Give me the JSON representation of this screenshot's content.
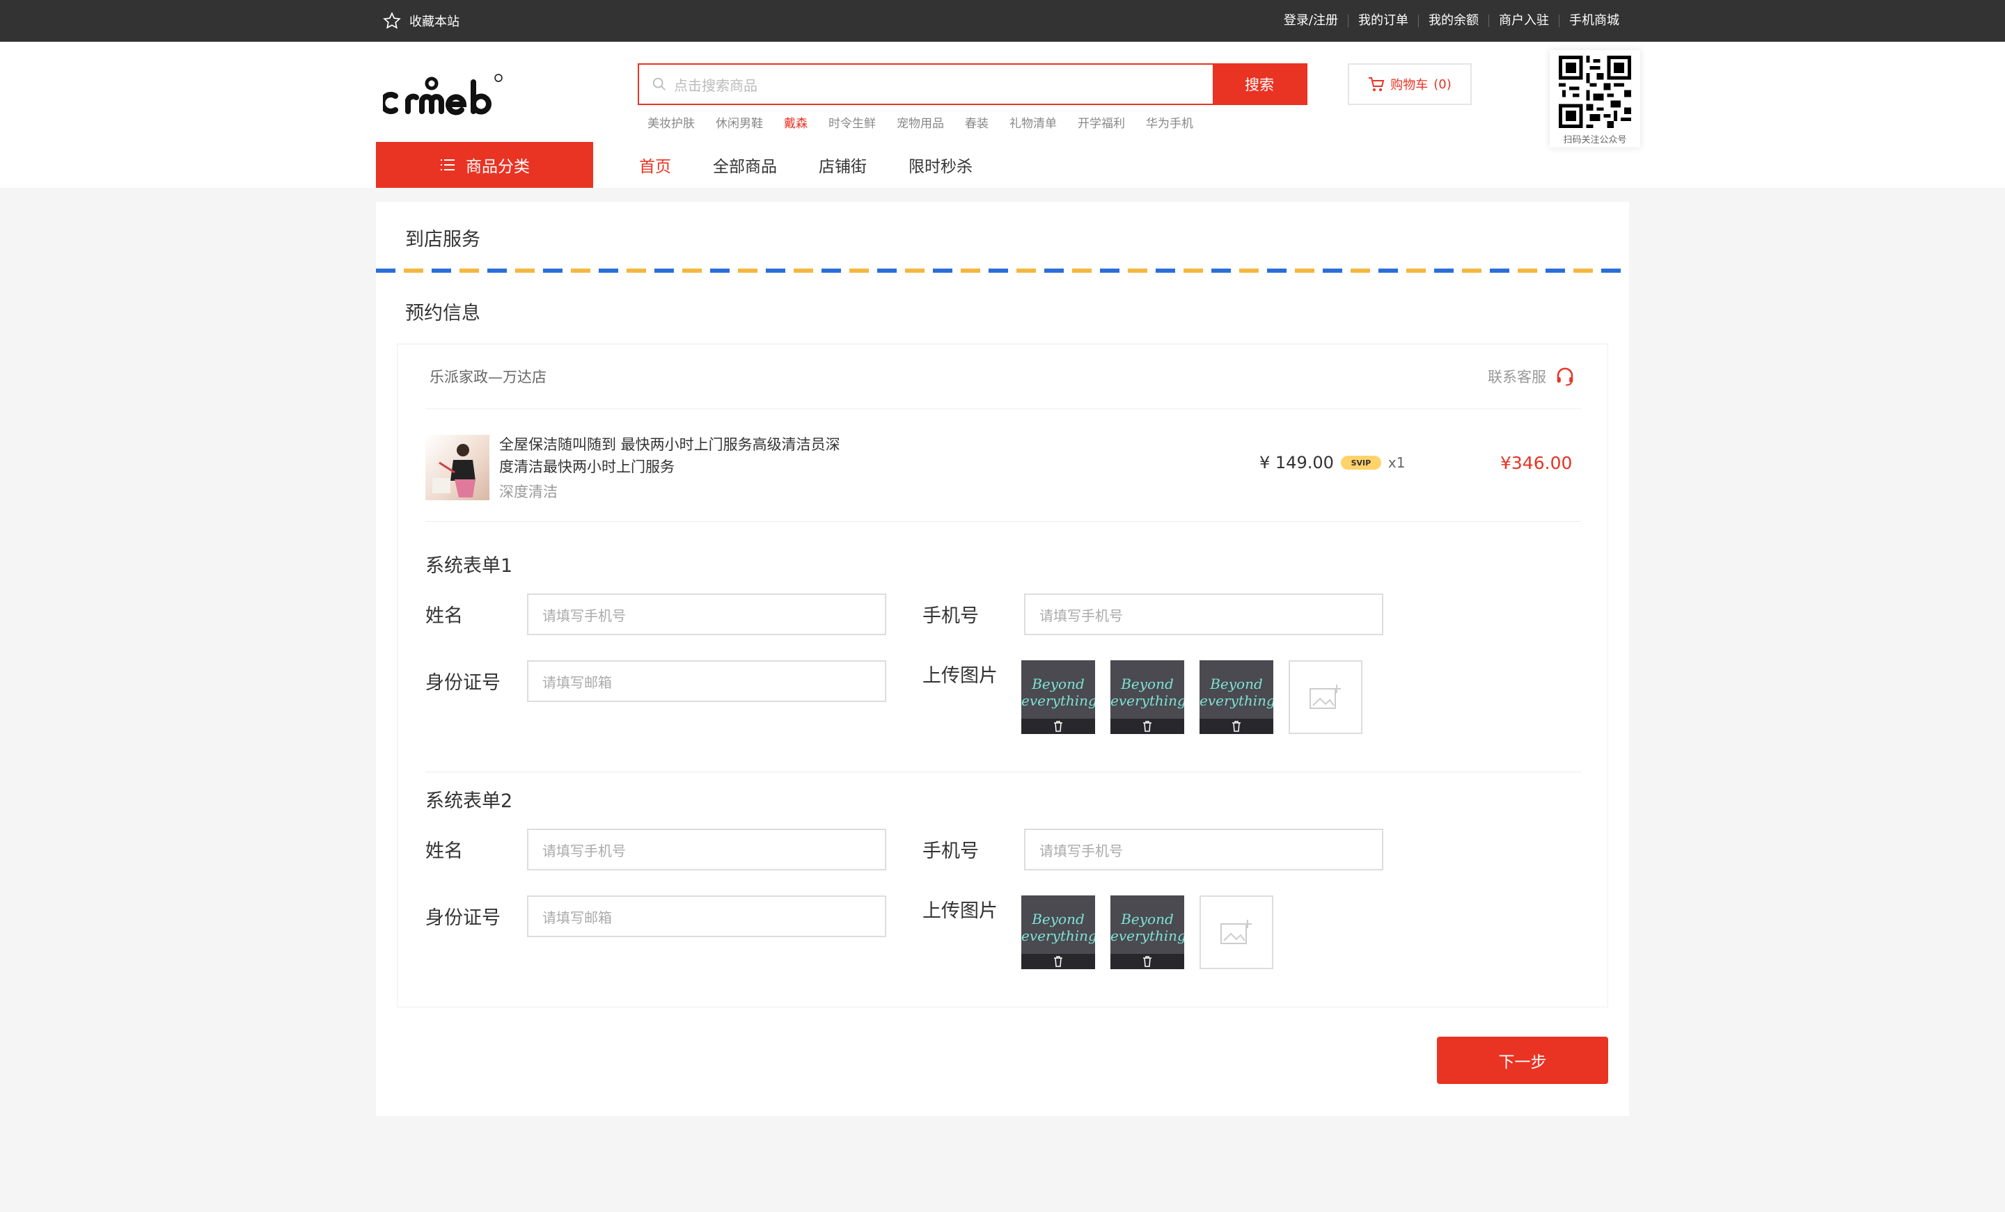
{
  "topbar": {
    "favorite": "收藏本站",
    "links": [
      "登录/注册",
      "我的订单",
      "我的余额",
      "商户入驻",
      "手机商城"
    ]
  },
  "header": {
    "search_placeholder": "点击搜索商品",
    "search_button": "搜索",
    "hot_words": [
      "美妆护肤",
      "休闲男鞋",
      "戴森",
      "时令生鲜",
      "宠物用品",
      "春装",
      "礼物清单",
      "开学福利",
      "华为手机"
    ],
    "hot_highlight_index": 2,
    "cart_label": "购物车",
    "cart_count": "(0)",
    "qr_caption": "扫码关注公众号"
  },
  "nav": {
    "category": "商品分类",
    "items": [
      "首页",
      "全部商品",
      "店铺街",
      "限时秒杀"
    ],
    "active_index": 0
  },
  "page": {
    "section_title": "到店服务",
    "booking_title": "预约信息",
    "store_name": "乐派家政—万达店",
    "service": "联系客服",
    "product": {
      "title": "全屋保洁随叫随到 最快两小时上门服务高级清洁员深度清洁最快两小时上门服务",
      "spec": "深度清洁",
      "price": "¥ 149.00",
      "vip_badge": "SVIP",
      "qty": "x1",
      "total": "¥346.00"
    },
    "forms": [
      {
        "title": "系统表单1",
        "name_label": "姓名",
        "name_placeholder": "请填写手机号",
        "phone_label": "手机号",
        "phone_placeholder": "请填写手机号",
        "id_label": "身份证号",
        "id_placeholder": "请填写邮箱",
        "upload_label": "上传图片",
        "images": [
          "Beyond everything",
          "Beyond everything",
          "Beyond everything"
        ]
      },
      {
        "title": "系统表单2",
        "name_label": "姓名",
        "name_placeholder": "请填写手机号",
        "phone_label": "手机号",
        "phone_placeholder": "请填写手机号",
        "id_label": "身份证号",
        "id_placeholder": "请填写邮箱",
        "upload_label": "上传图片",
        "images": [
          "Beyond everything",
          "Beyond everything"
        ]
      }
    ],
    "next_button": "下一步"
  },
  "colors": {
    "accent": "#e93323",
    "topbar": "#333333",
    "stripe_blue": "#2b6ed9",
    "stripe_yellow": "#f4b740"
  }
}
